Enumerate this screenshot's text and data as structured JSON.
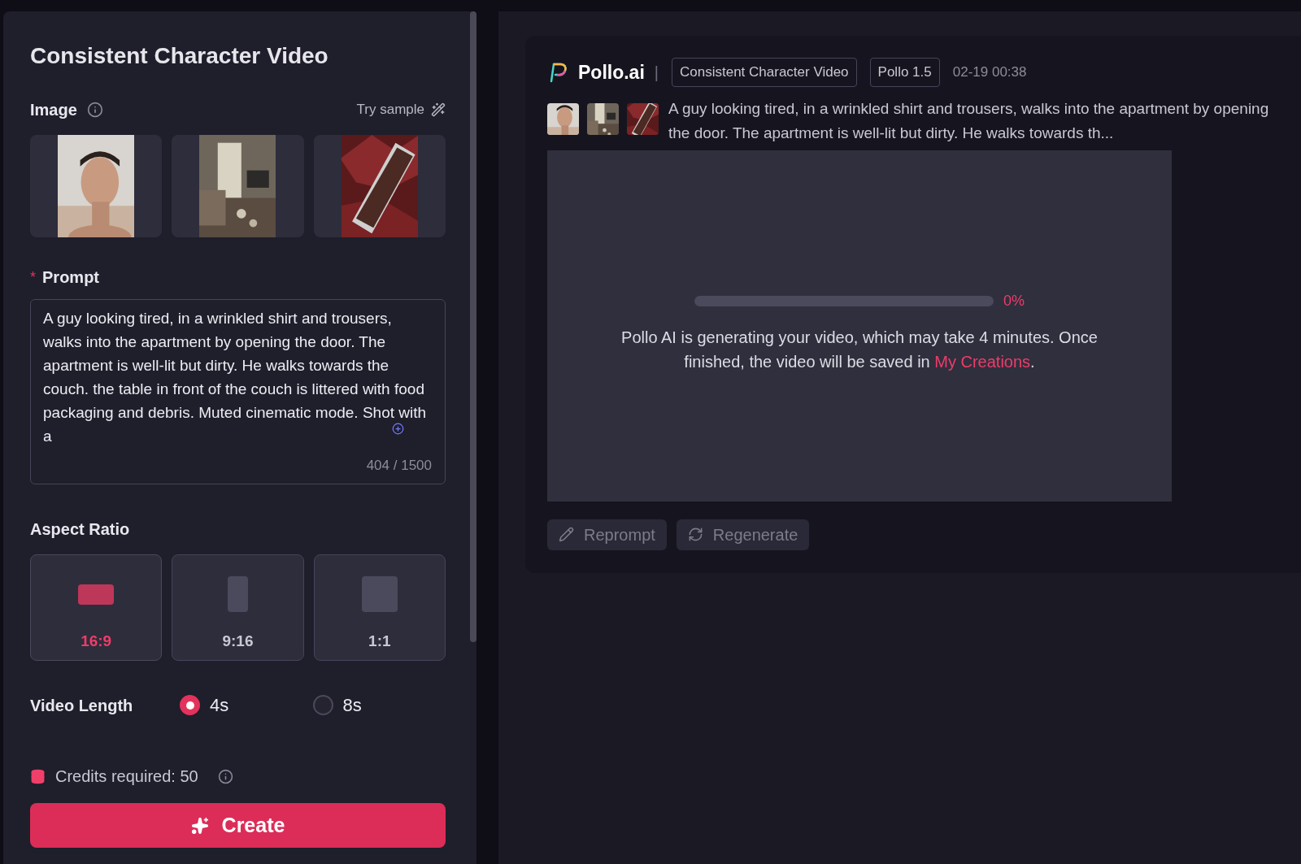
{
  "form": {
    "title": "Consistent Character Video",
    "image": {
      "label": "Image",
      "try_sample": "Try sample",
      "thumbnails": [
        {
          "kind": "picture"
        },
        {
          "kind": "picture"
        },
        {
          "kind": "picture"
        }
      ]
    },
    "prompt": {
      "label": "Prompt",
      "required_mark": "*",
      "value": "A guy looking tired, in a wrinkled shirt and trousers, walks into the apartment by opening the door. The apartment is well-lit but dirty. He walks towards the couch. the table in front of the couch is littered with food packaging and debris. Muted cinematic mode. Shot with a",
      "counter": "404 / 1500"
    },
    "aspect_ratio": {
      "label": "Aspect Ratio",
      "options": [
        {
          "label": "16:9",
          "kind": "landscape",
          "selected": true
        },
        {
          "label": "9:16",
          "kind": "portrait",
          "selected": false
        },
        {
          "label": "1:1",
          "kind": "square",
          "selected": false
        }
      ]
    },
    "video_length": {
      "label": "Video Length",
      "options": [
        {
          "label": "4s",
          "selected": true
        },
        {
          "label": "8s",
          "selected": false
        }
      ]
    },
    "credits": "Credits required: 50",
    "create_button": "Create"
  },
  "result": {
    "brand": "Pollo.ai",
    "separator": "|",
    "tags": [
      "Consistent Character Video",
      "Pollo 1.5"
    ],
    "time": "02-19 00:38",
    "thumbnails": [
      {
        "kind": "picture"
      },
      {
        "kind": "picture"
      },
      {
        "kind": "picture"
      }
    ],
    "description": "A guy looking tired, in a wrinkled shirt and trousers, walks into the apartment by opening the door. The apartment is well-lit but dirty. He walks towards th...",
    "progress": {
      "level": 0,
      "reading": "0%"
    },
    "message": "Pollo AI is generating your video, which may take 4 minutes. Once finished, the video will be saved in ",
    "message_link": "My Creations",
    "message_end": ".",
    "buttons": [
      {
        "label": "Reprompt",
        "kind": "edit",
        "disabled": true
      },
      {
        "label": "Regenerate",
        "kind": "refresh",
        "disabled": true
      }
    ]
  }
}
